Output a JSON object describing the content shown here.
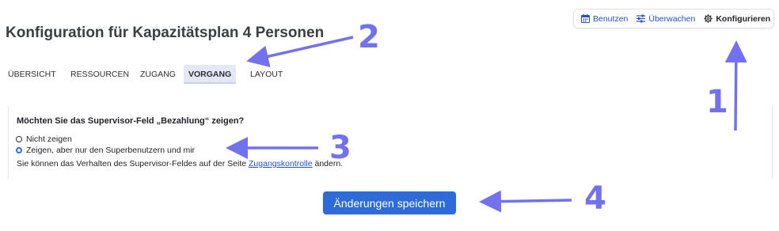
{
  "page": {
    "title": "Konfiguration für Kapazitätsplan 4 Personen"
  },
  "top_nav": {
    "items": [
      {
        "label": "Benutzen",
        "icon": "calendar-icon",
        "active": false
      },
      {
        "label": "Überwachen",
        "icon": "sliders-icon",
        "active": false
      },
      {
        "label": "Konfigurieren",
        "icon": "gear-icon",
        "active": true
      }
    ]
  },
  "tabs": [
    {
      "label": "ÜBERSICHT",
      "active": false
    },
    {
      "label": "RESSOURCEN",
      "active": false
    },
    {
      "label": "ZUGANG",
      "active": false
    },
    {
      "label": "VORGANG",
      "active": true
    },
    {
      "label": "LAYOUT",
      "active": false
    }
  ],
  "form": {
    "question": "Möchten Sie das Supervisor-Feld „Bezahlung“ zeigen?",
    "options": [
      {
        "label": "Nicht zeigen",
        "checked": false
      },
      {
        "label": "Zeigen, aber nur den Superbenutzern und mir",
        "checked": true
      }
    ],
    "hint_before": "Sie können das Verhalten des Supervisor-Feldes auf der Seite ",
    "hint_link": "Zugangskontrolle",
    "hint_after": " ändern."
  },
  "save_button": {
    "label": "Änderungen speichern"
  },
  "annotations": {
    "color": "#7271ee",
    "markers": [
      "1",
      "2",
      "3",
      "4"
    ]
  },
  "colors": {
    "accent": "#2e6bd9",
    "link": "#2453c6",
    "active_tab_bg": "#e4e8f5"
  }
}
